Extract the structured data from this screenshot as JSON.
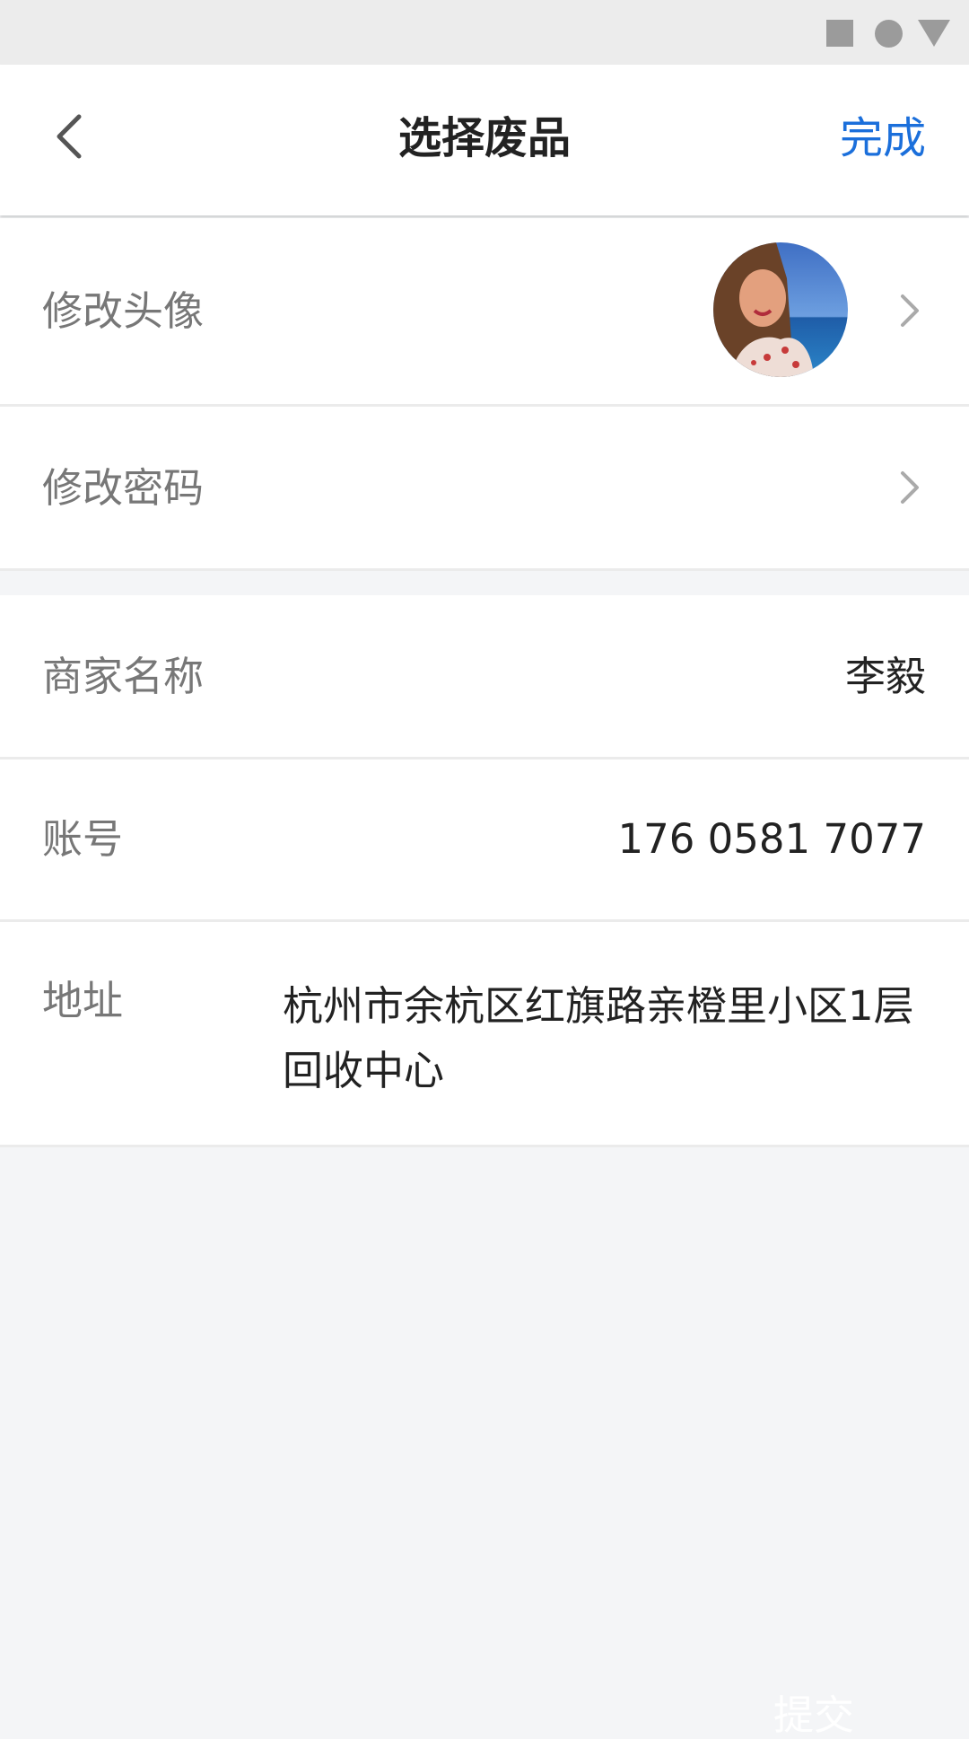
{
  "header": {
    "title": "选择废品",
    "done_label": "完成"
  },
  "profile": {
    "avatar_label": "修改头像",
    "password_label": "修改密码"
  },
  "info": {
    "merchant_label": "商家名称",
    "merchant_value": "李毅",
    "account_label": "账号",
    "account_value": "176 0581 7077",
    "address_label": "地址",
    "address_value": "杭州市余杭区红旗路亲橙里小区1层回收中心"
  },
  "footer": {
    "submit_label": "提交"
  },
  "icons": {
    "back": "chevron-left-icon",
    "row_arrow": "chevron-right-icon"
  },
  "colors": {
    "accent": "#1b6fdb",
    "background": "#f4f5f7"
  }
}
